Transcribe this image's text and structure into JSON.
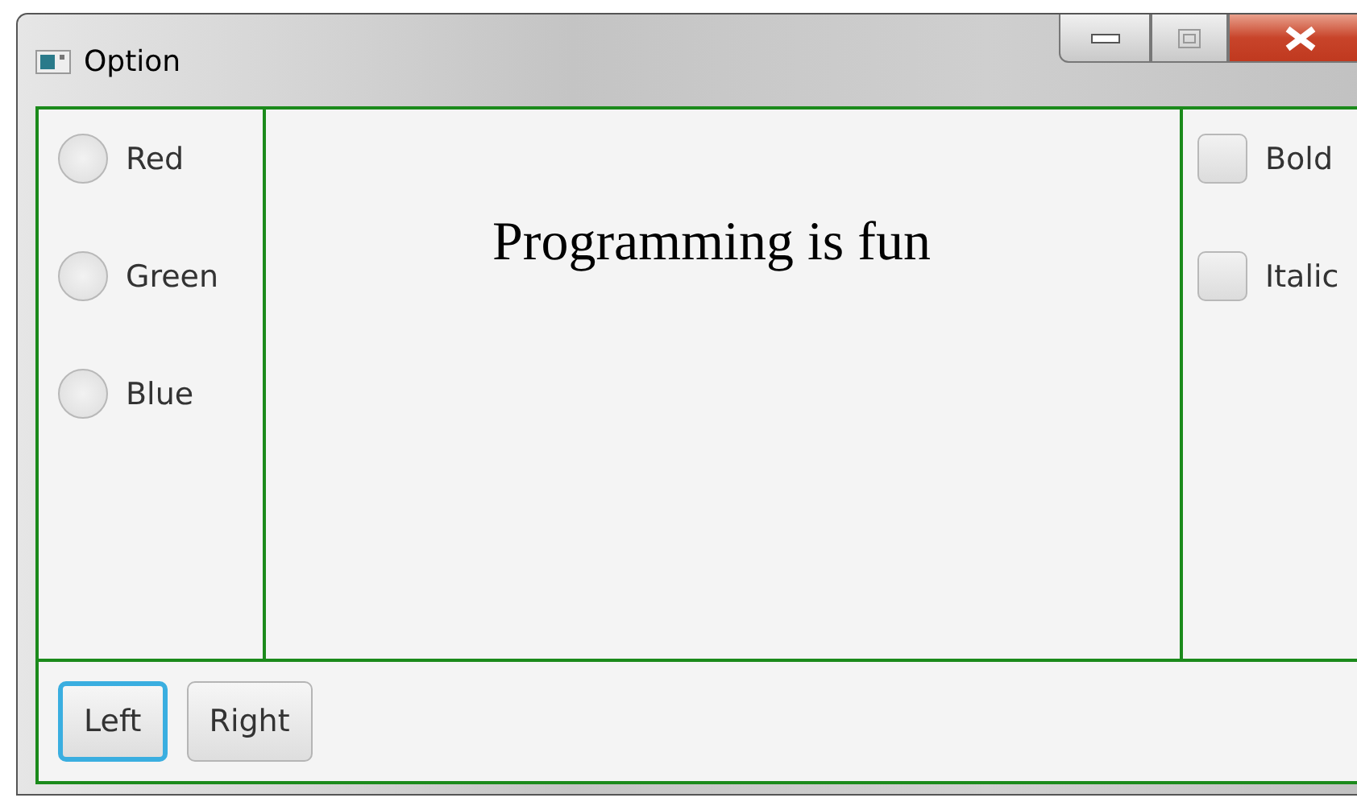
{
  "window": {
    "title": "Option"
  },
  "colors": [
    {
      "label": "Red",
      "selected": false
    },
    {
      "label": "Green",
      "selected": false
    },
    {
      "label": "Blue",
      "selected": false
    }
  ],
  "message": "Programming is fun",
  "styles": [
    {
      "label": "Bold",
      "checked": false
    },
    {
      "label": "Italic",
      "checked": false
    }
  ],
  "buttons": [
    {
      "label": "Left",
      "focused": true
    },
    {
      "label": "Right",
      "focused": false
    }
  ]
}
